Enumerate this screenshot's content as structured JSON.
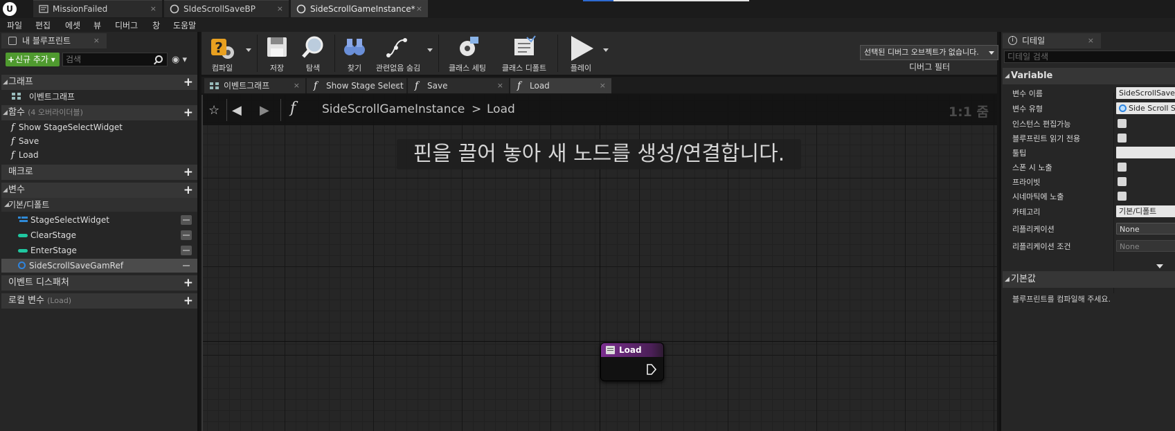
{
  "document_tabs": [
    {
      "label": "MissionFailed",
      "close": "×",
      "icon": "blueprint-icon"
    },
    {
      "label": "SIdeScrollSaveBP",
      "close": "×",
      "icon": "circle-blueprint-icon"
    },
    {
      "label": "SideScrollGameInstance*",
      "close": "×",
      "icon": "circle-blueprint-icon"
    }
  ],
  "menu": [
    "파일",
    "편집",
    "에셋",
    "뷰",
    "디버그",
    "창",
    "도움말"
  ],
  "my_blueprint": {
    "tab_label": "내 블루프린트",
    "tab_close": "×",
    "add_new_label": "신규 추가",
    "search_placeholder": "검색",
    "graph_section": "그래프",
    "event_graph_item": "이벤트그래프",
    "functions_section": "함수",
    "functions_override": "(4 오버라이더블)",
    "functions": [
      "Show StageSelectWidget",
      "Save",
      "Load"
    ],
    "macros_section": "매크로",
    "variables_section": "변수",
    "default_category": "기본/디폴트",
    "variables": [
      {
        "name": "StageSelectWidget",
        "type_color": "#2f8ad8"
      },
      {
        "name": "ClearStage",
        "type_color": "#1fc7a0"
      },
      {
        "name": "EnterStage",
        "type_color": "#1fc7a0"
      },
      {
        "name": "SideScrollSaveGamRef",
        "type_color": "#2e85e0"
      }
    ],
    "event_dispatchers_section": "이벤트 디스패처",
    "local_vars_section": "로컬 변수",
    "local_vars_context": "(Load)"
  },
  "toolbar": {
    "compile": "컴파일",
    "save": "저장",
    "browse": "탐색",
    "find": "찾기",
    "hide_unrelated": "관련없음 숨김",
    "class_settings": "클래스 세팅",
    "class_defaults": "클래스 디폴트",
    "play": "플레이",
    "debug_object": "선택된 디버그 오브젝트가 없습니다.",
    "debug_filter": "디버그 필터"
  },
  "graph_tabs": [
    {
      "label": "이벤트그래프",
      "close": "×"
    },
    {
      "label": "Show Stage Select",
      "close": "×"
    },
    {
      "label": "Save",
      "close": "×"
    },
    {
      "label": "Load",
      "close": "×"
    }
  ],
  "graph": {
    "breadcrumb_root": "SideScrollGameInstance",
    "breadcrumb_sep": ">",
    "breadcrumb_leaf": "Load",
    "zoom": "1:1 줌",
    "hint": "핀을 끌어 놓아 새 노드를 생성/연결합니다.",
    "node_title": "Load"
  },
  "details": {
    "tab_label": "디테일",
    "tab_close": "×",
    "search_placeholder": "디테일 검색",
    "variable_section": "Variable",
    "rows": {
      "var_name_label": "변수 이름",
      "var_name_value": "SideScrollSaveG",
      "var_type_label": "변수 유형",
      "var_type_value": "Side Scroll Sa",
      "instance_editable": "인스턴스 편집가능",
      "bp_read_only": "블루프린트 읽기 전용",
      "tooltip": "툴팁",
      "expose_on_spawn": "스폰 시 노출",
      "private": "프라이빗",
      "expose_cinematics": "시네마틱에 노출",
      "category_label": "카테고리",
      "category_value": "기본/디폴트",
      "replication_label": "리플리케이션",
      "replication_value": "None",
      "replication_cond_label": "리플리케이션 조건",
      "replication_cond_value": "None"
    },
    "default_section": "기본값",
    "default_message": "블루프린트를 컴파일해 주세요."
  },
  "colors": {
    "add_button": "#4f9a2f",
    "function_node_header": "#7b2f8f",
    "object_ref": "#2e85e0",
    "bool_var": "#1fc7a0"
  }
}
